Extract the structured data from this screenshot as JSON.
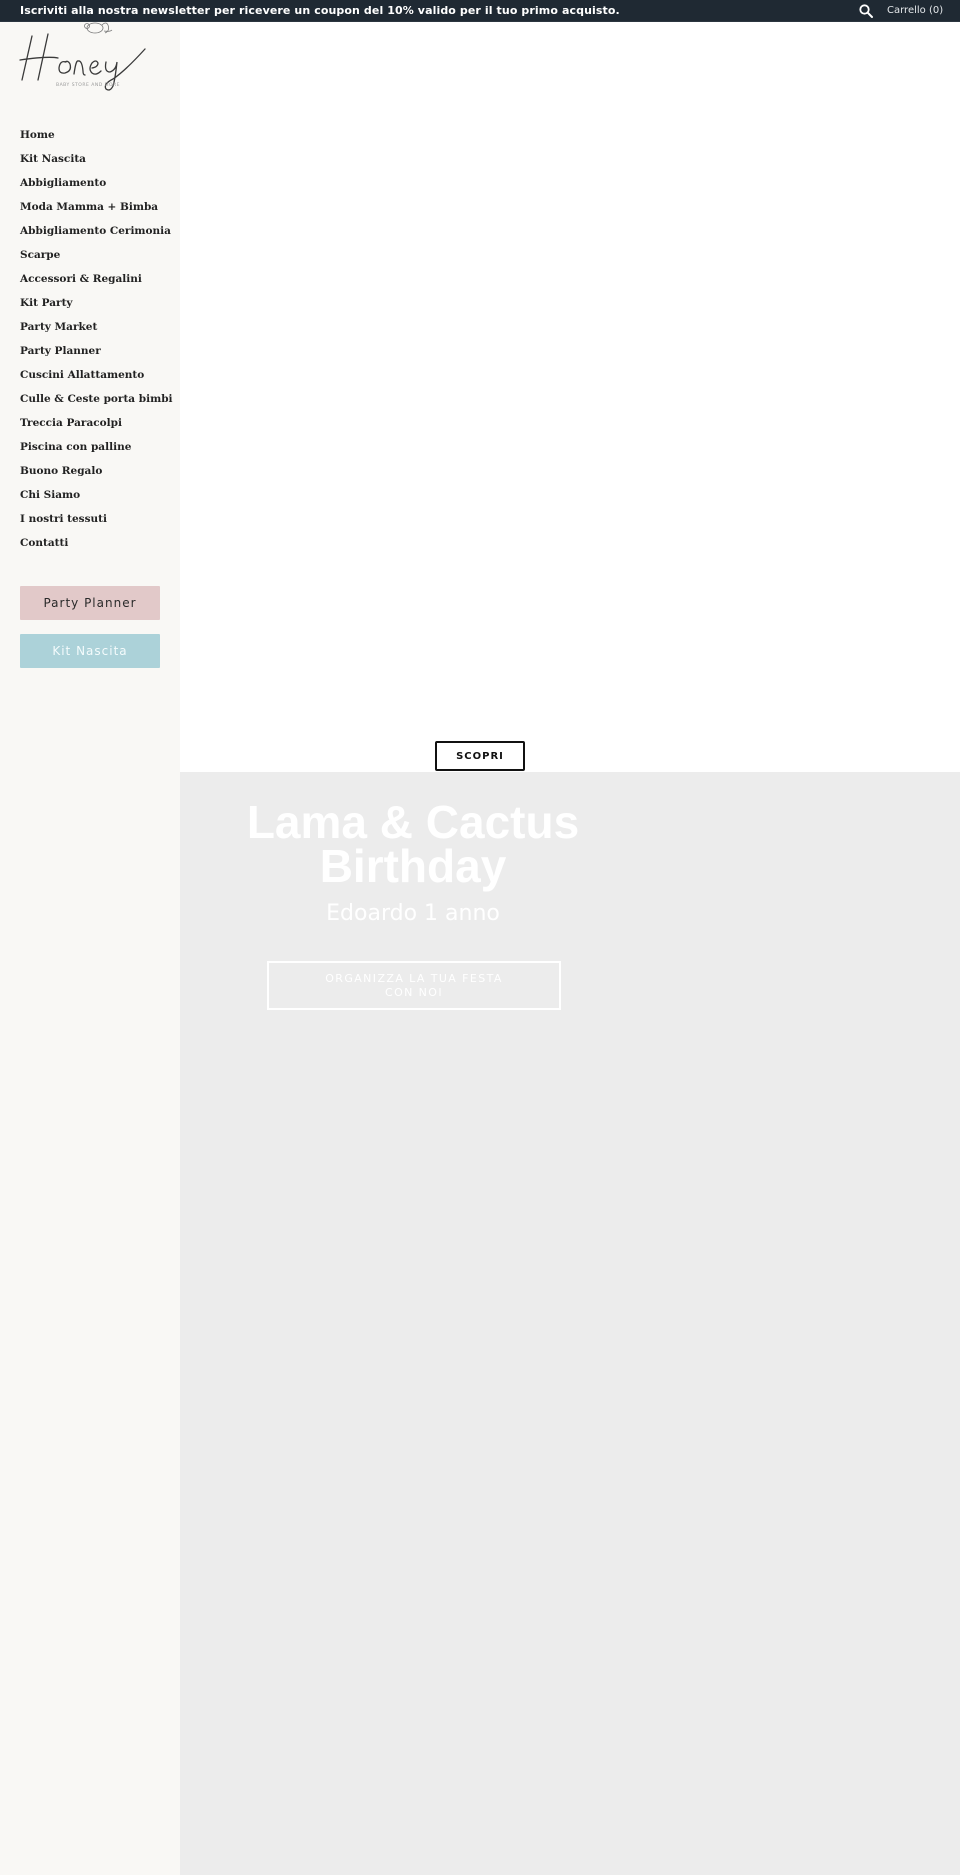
{
  "topbar": {
    "announcement": "Iscriviti alla nostra newsletter per ricevere un coupon del 10% valido per il tuo primo acquisto.",
    "search_icon": "search-icon",
    "cart_label": "Carrello (0)"
  },
  "logo": {
    "brand": "Honey",
    "tagline": "BABY STORE AND MORE"
  },
  "sidebar": {
    "nav": [
      {
        "label": "Home"
      },
      {
        "label": "Kit Nascita"
      },
      {
        "label": "Abbigliamento"
      },
      {
        "label": "Moda Mamma + Bimba"
      },
      {
        "label": "Abbigliamento Cerimonia"
      },
      {
        "label": "Scarpe"
      },
      {
        "label": "Accessori & Regalini"
      },
      {
        "label": "Kit Party"
      },
      {
        "label": "Party Market"
      },
      {
        "label": "Party Planner"
      },
      {
        "label": "Cuscini Allattamento"
      },
      {
        "label": "Culle & Ceste porta bimbi"
      },
      {
        "label": "Treccia Paracolpi"
      },
      {
        "label": "Piscina con palline"
      },
      {
        "label": "Buono Regalo"
      },
      {
        "label": "Chi Siamo"
      },
      {
        "label": "I nostri tessuti"
      },
      {
        "label": "Contatti"
      }
    ],
    "buttons": {
      "party_planner": "Party Planner",
      "kit_nascita": "Kit Nascita"
    }
  },
  "main": {
    "scopri_label": "SCOPRI",
    "hero": {
      "title": "Lama & Cactus Birthday",
      "subtitle": "Edoardo 1 anno",
      "cta_label": "ORGANIZZA LA TUA FESTA CON NOI"
    }
  },
  "colors": {
    "topbar_bg": "#1f2933",
    "sidebar_bg": "#f9f8f5",
    "pink_button": "#e2c9c9",
    "teal_button": "#acd2d9",
    "hero_bg": "#ececec"
  }
}
